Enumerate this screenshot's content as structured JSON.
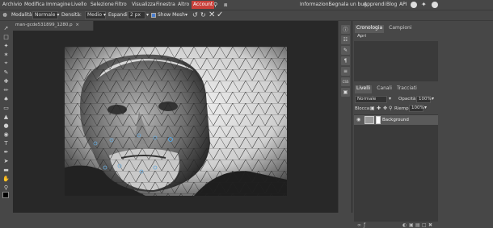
{
  "menubar": {
    "items": [
      "Archivio",
      "Modifica",
      "Immagine",
      "Livello",
      "Selezione",
      "Filtro",
      "Visualizza",
      "Finestra",
      "Altro",
      "Account"
    ],
    "right_links": [
      "Informazioni",
      "Segnala un bug",
      "Apprendi",
      "Blog",
      "API"
    ]
  },
  "options": {
    "mode_label": "Modalità:",
    "mode_value": "Normale",
    "density_label": "Densità:",
    "density_value": "Medio",
    "expand_label": "Espandi:",
    "expand_value": "2 px",
    "show_mesh_label": "Show Mesh"
  },
  "document": {
    "tab_title": "man-gcde531899_1280.p"
  },
  "panels": {
    "history_tabs": [
      "Cronologia",
      "Campioni"
    ],
    "history_item": "Apri",
    "layer_tabs": [
      "Livelli",
      "Canali",
      "Tracciati"
    ],
    "blend_mode": "Normale",
    "opacity_label": "Opacità:",
    "opacity_value": "100%",
    "lock_label": "Blocca:",
    "fill_label": "Riempi:",
    "fill_value": "100%",
    "layer_name": "Background"
  },
  "mini_panel": {
    "css_label": "CSS"
  }
}
